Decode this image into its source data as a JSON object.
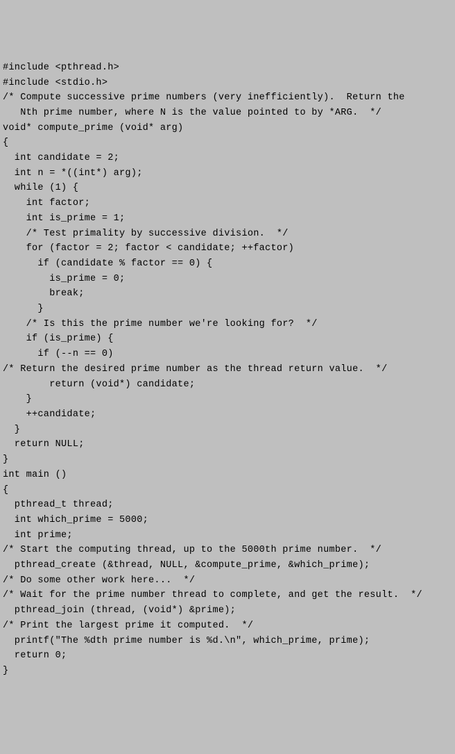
{
  "code": {
    "lines": [
      "#include <pthread.h>",
      "#include <stdio.h>",
      "/* Compute successive prime numbers (very inefficiently).  Return the",
      "   Nth prime number, where N is the value pointed to by *ARG.  */",
      "void* compute_prime (void* arg)",
      "{",
      "  int candidate = 2;",
      "  int n = *((int*) arg);",
      "  while (1) {",
      "    int factor;",
      "    int is_prime = 1;",
      "    /* Test primality by successive division.  */",
      "    for (factor = 2; factor < candidate; ++factor)",
      "      if (candidate % factor == 0) {",
      "        is_prime = 0;",
      "        break;",
      "      }",
      "    /* Is this the prime number we're looking for?  */",
      "    if (is_prime) {",
      "      if (--n == 0)",
      "/* Return the desired prime number as the thread return value.  */",
      "        return (void*) candidate;",
      "    }",
      "    ++candidate;",
      "  }",
      "  return NULL;",
      "}",
      "int main ()",
      "{",
      "  pthread_t thread;",
      "  int which_prime = 5000;",
      "  int prime;",
      "/* Start the computing thread, up to the 5000th prime number.  */",
      "  pthread_create (&thread, NULL, &compute_prime, &which_prime);",
      "/* Do some other work here...  */",
      "/* Wait for the prime number thread to complete, and get the result.  */",
      "  pthread_join (thread, (void*) &prime);",
      "/* Print the largest prime it computed.  */",
      "  printf(\"The %dth prime number is %d.\\n\", which_prime, prime);",
      "  return 0;",
      "}"
    ]
  }
}
